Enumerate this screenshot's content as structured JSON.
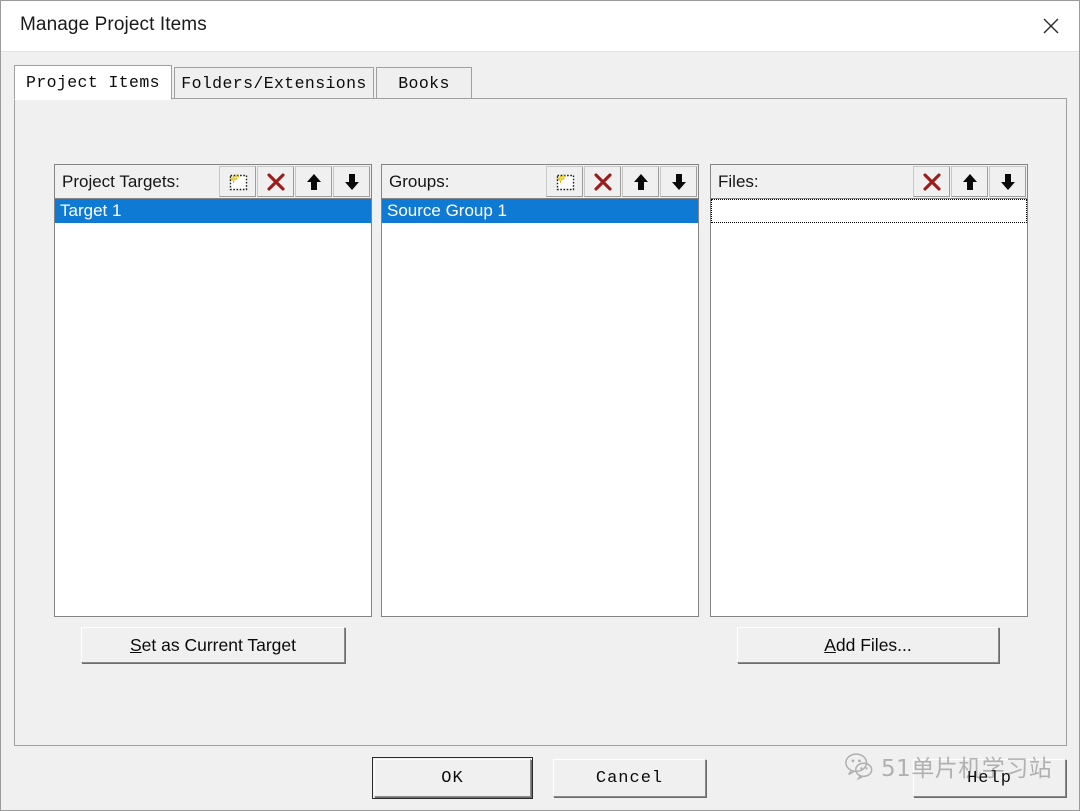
{
  "window": {
    "title": "Manage Project Items",
    "close_icon": "close-icon"
  },
  "tabs": [
    {
      "label": "Project Items",
      "active": true
    },
    {
      "label": "Folders/Extensions",
      "active": false
    },
    {
      "label": "Books",
      "active": false
    }
  ],
  "columns": {
    "targets": {
      "label": "Project Targets:",
      "icons": [
        "new-item-icon",
        "delete-icon",
        "move-up-icon",
        "move-down-icon"
      ],
      "items": [
        {
          "text": "Target 1",
          "selected": true
        }
      ]
    },
    "groups": {
      "label": "Groups:",
      "icons": [
        "new-item-icon",
        "delete-icon",
        "move-up-icon",
        "move-down-icon"
      ],
      "items": [
        {
          "text": "Source Group 1",
          "selected": true
        }
      ]
    },
    "files": {
      "label": "Files:",
      "icons": [
        "delete-icon",
        "move-up-icon",
        "move-down-icon"
      ],
      "items": [
        {
          "text": "",
          "selected": false,
          "focused": true
        }
      ]
    }
  },
  "buttons": {
    "set_as_current_target": {
      "accel": "S",
      "rest": "et as Current Target"
    },
    "add_files": {
      "accel": "A",
      "rest": "dd Files..."
    },
    "ok": "OK",
    "cancel": "Cancel",
    "help": "Help"
  },
  "watermark": {
    "text": "51单片机学习站",
    "icon": "wechat-icon"
  },
  "colors": {
    "selection_blue": "#0e7ad4",
    "dialog_face": "#f0f0f0",
    "title_bar": "#ffffff",
    "delete_icon_red": "#9e1b1b",
    "sparkle_yellow": "#f5e03a"
  }
}
